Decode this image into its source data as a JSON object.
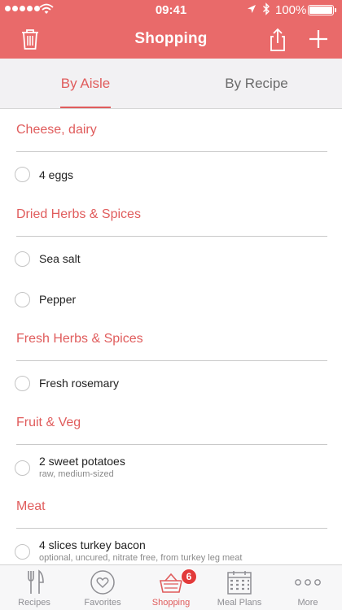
{
  "status_bar": {
    "time": "09:41",
    "battery": "100%"
  },
  "nav": {
    "title": "Shopping"
  },
  "tabs": [
    {
      "label": "By Aisle",
      "selected": true
    },
    {
      "label": "By Recipe",
      "selected": false
    }
  ],
  "sections": [
    {
      "title": "Cheese, dairy",
      "items": [
        {
          "name": "4 eggs",
          "note": ""
        }
      ]
    },
    {
      "title": "Dried Herbs & Spices",
      "items": [
        {
          "name": "Sea salt",
          "note": ""
        },
        {
          "name": "Pepper",
          "note": ""
        }
      ]
    },
    {
      "title": "Fresh Herbs & Spices",
      "items": [
        {
          "name": "Fresh rosemary",
          "note": ""
        }
      ]
    },
    {
      "title": "Fruit & Veg",
      "items": [
        {
          "name": "2 sweet potatoes",
          "note": "raw, medium-sized"
        }
      ]
    },
    {
      "title": "Meat",
      "items": [
        {
          "name": "4 slices turkey bacon",
          "note": "optional, uncured, nitrate free, from turkey leg meat"
        }
      ]
    }
  ],
  "tabbar": [
    {
      "label": "Recipes",
      "icon": "fork-knife-icon"
    },
    {
      "label": "Favorites",
      "icon": "heart-icon"
    },
    {
      "label": "Shopping",
      "icon": "basket-icon",
      "badge": "6",
      "active": true
    },
    {
      "label": "Meal Plans",
      "icon": "calendar-icon"
    },
    {
      "label": "More",
      "icon": "ellipsis-icon"
    }
  ],
  "colors": {
    "accent": "#e96a6a",
    "badge": "#e23a3a"
  }
}
